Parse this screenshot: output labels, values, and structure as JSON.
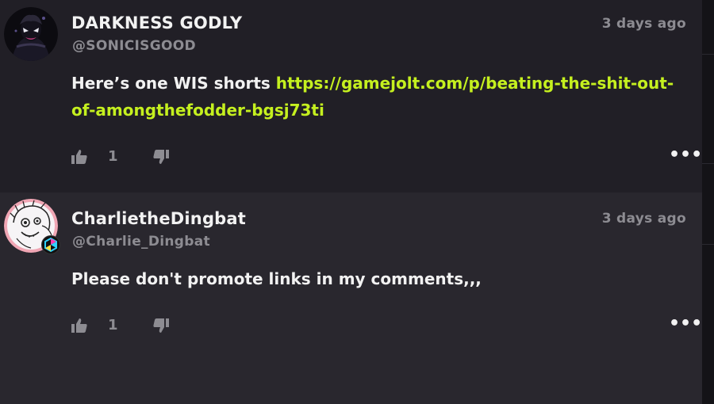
{
  "comments": [
    {
      "display_name": "DARKNESS GODLY",
      "handle": "@SONICISGOOD",
      "timestamp": "3 days ago",
      "text": "Here’s one WIS shorts ",
      "link": "https://gamejolt.com/p/beating-the-shit-out-of-amongthefodder-bgsj73ti",
      "likes": "1",
      "avatar_icon": "dark-character-avatar",
      "more_icon": "more-options-icon"
    },
    {
      "display_name": "CharlietheDingbat",
      "handle": "@Charlie_Dingbat",
      "timestamp": "3 days ago",
      "text": "Please don't promote links in my comments,,,",
      "likes": "1",
      "avatar_icon": "sketch-character-avatar",
      "badge_icon": "verified-creator-badge-icon",
      "more_icon": "more-options-icon"
    }
  ],
  "colors": {
    "background": "#1d1c21",
    "comment_bg_1": "#211f26",
    "comment_bg_2": "#29272e",
    "link": "#c5f01f",
    "text": "#f2f2f2",
    "muted": "#8d8c92"
  }
}
